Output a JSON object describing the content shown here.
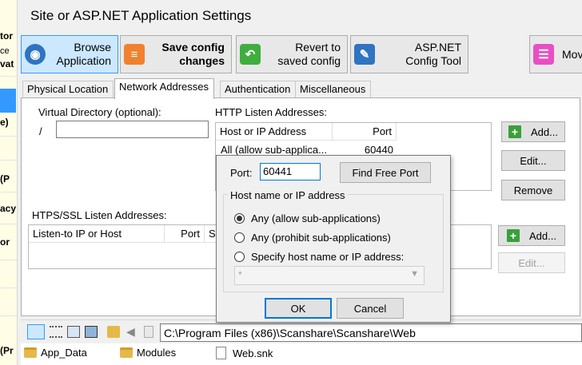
{
  "left_strip": {
    "fragments": [
      "tor",
      "ce",
      "vat",
      "e)",
      "(P",
      "acy",
      "or",
      "(Pr"
    ]
  },
  "window": {
    "title": "Site or ASP.NET Application Settings"
  },
  "toolbar": {
    "browse_label": "Browse\nApplication",
    "save_label": "Save config\nchanges",
    "revert_label": "Revert to\nsaved config",
    "aspnet_label": "ASP.NET\nConfig Tool",
    "move_label": "Mov"
  },
  "tabs": [
    {
      "label": "Physical Location"
    },
    {
      "label": "Network Addresses"
    },
    {
      "label": "Authentication"
    },
    {
      "label": "Miscellaneous"
    }
  ],
  "network": {
    "vdir_label": "Virtual Directory (optional):",
    "vdir_prefix": "/",
    "vdir_value": "",
    "http_label": "HTTP Listen Addresses:",
    "http_columns": [
      "Host or IP Address",
      "Port"
    ],
    "http_rows": [
      {
        "host": "All (allow sub-applica...",
        "port": "60440"
      }
    ],
    "add_label": "Add...",
    "edit_label": "Edit...",
    "remove_label": "Remove",
    "https_label": "HTPS/SSL Listen Addresses:",
    "https_columns": [
      "Listen-to IP or Host",
      "Port",
      "Se"
    ],
    "https_add_label": "Add...",
    "https_edit_label": "Edit..."
  },
  "popup": {
    "port_label": "Port:",
    "port_value": "60441",
    "find_port_label": "Find Free Port",
    "group_title": "Host name or IP address",
    "options": [
      {
        "label": "Any (allow sub-applications)",
        "selected": true
      },
      {
        "label": "Any (prohibit sub-applications)",
        "selected": false
      },
      {
        "label": "Specify host name or IP address:",
        "selected": false
      }
    ],
    "host_value": "*",
    "ok_label": "OK",
    "cancel_label": "Cancel"
  },
  "bottom": {
    "path": "C:\\Program Files (x86)\\Scanshare\\Scanshare\\Web",
    "files": [
      {
        "name": "App_Data",
        "icon": "folder-icon"
      },
      {
        "name": "Modules",
        "icon": "folder-icon"
      },
      {
        "name": "Web.snk",
        "icon": "file-icon"
      }
    ]
  },
  "colors": {
    "accent": "#3399ff",
    "selected_button_bg": "#cce8ff",
    "save_icon": "#f0812e",
    "revert_icon": "#3fae3f",
    "aspnet_icon": "#2f74c0",
    "move_icon": "#e84fc4",
    "add_icon": "#3aa03a"
  }
}
